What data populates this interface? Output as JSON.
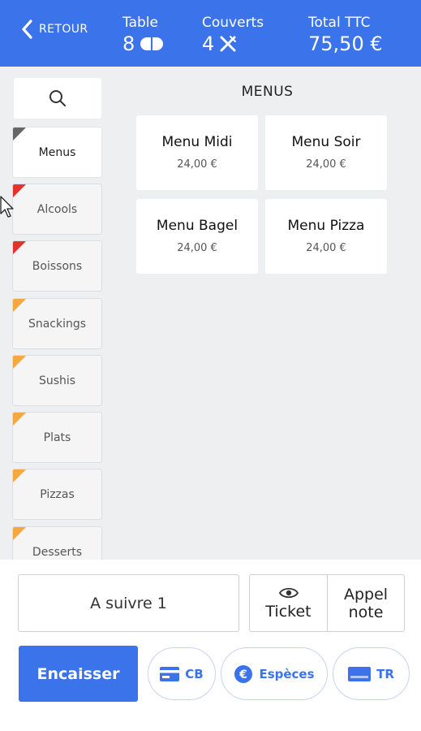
{
  "header": {
    "back_label": "RETOUR",
    "table_label": "Table",
    "table_value": "8",
    "couverts_label": "Couverts",
    "couverts_value": "4",
    "total_label": "Total TTC",
    "total_value": "75,50 €"
  },
  "section_title": "MENUS",
  "categories": [
    {
      "label": "Menus",
      "color": "#666666",
      "active": true
    },
    {
      "label": "Alcools",
      "color": "#e5322d"
    },
    {
      "label": "Boissons",
      "color": "#e5322d"
    },
    {
      "label": "Snackings",
      "color": "#f3a940"
    },
    {
      "label": "Sushis",
      "color": "#f3a940"
    },
    {
      "label": "Plats",
      "color": "#f3a940"
    },
    {
      "label": "Pizzas",
      "color": "#f3a940"
    },
    {
      "label": "Desserts",
      "color": "#f3a940"
    }
  ],
  "products": [
    {
      "name": "Menu Midi",
      "price": "24,00 €"
    },
    {
      "name": "Menu Soir",
      "price": "24,00 €"
    },
    {
      "name": "Menu Bagel",
      "price": "24,00 €"
    },
    {
      "name": "Menu Pizza",
      "price": "24,00 €"
    }
  ],
  "bottom": {
    "a_suivre": "A suivre 1",
    "ticket": "Ticket",
    "appel_line1": "Appel",
    "appel_line2": "note",
    "encaisser": "Encaisser",
    "cb": "CB",
    "especes": "Espèces",
    "tr": "TR"
  },
  "colors": {
    "accent": "#3b74ea"
  }
}
